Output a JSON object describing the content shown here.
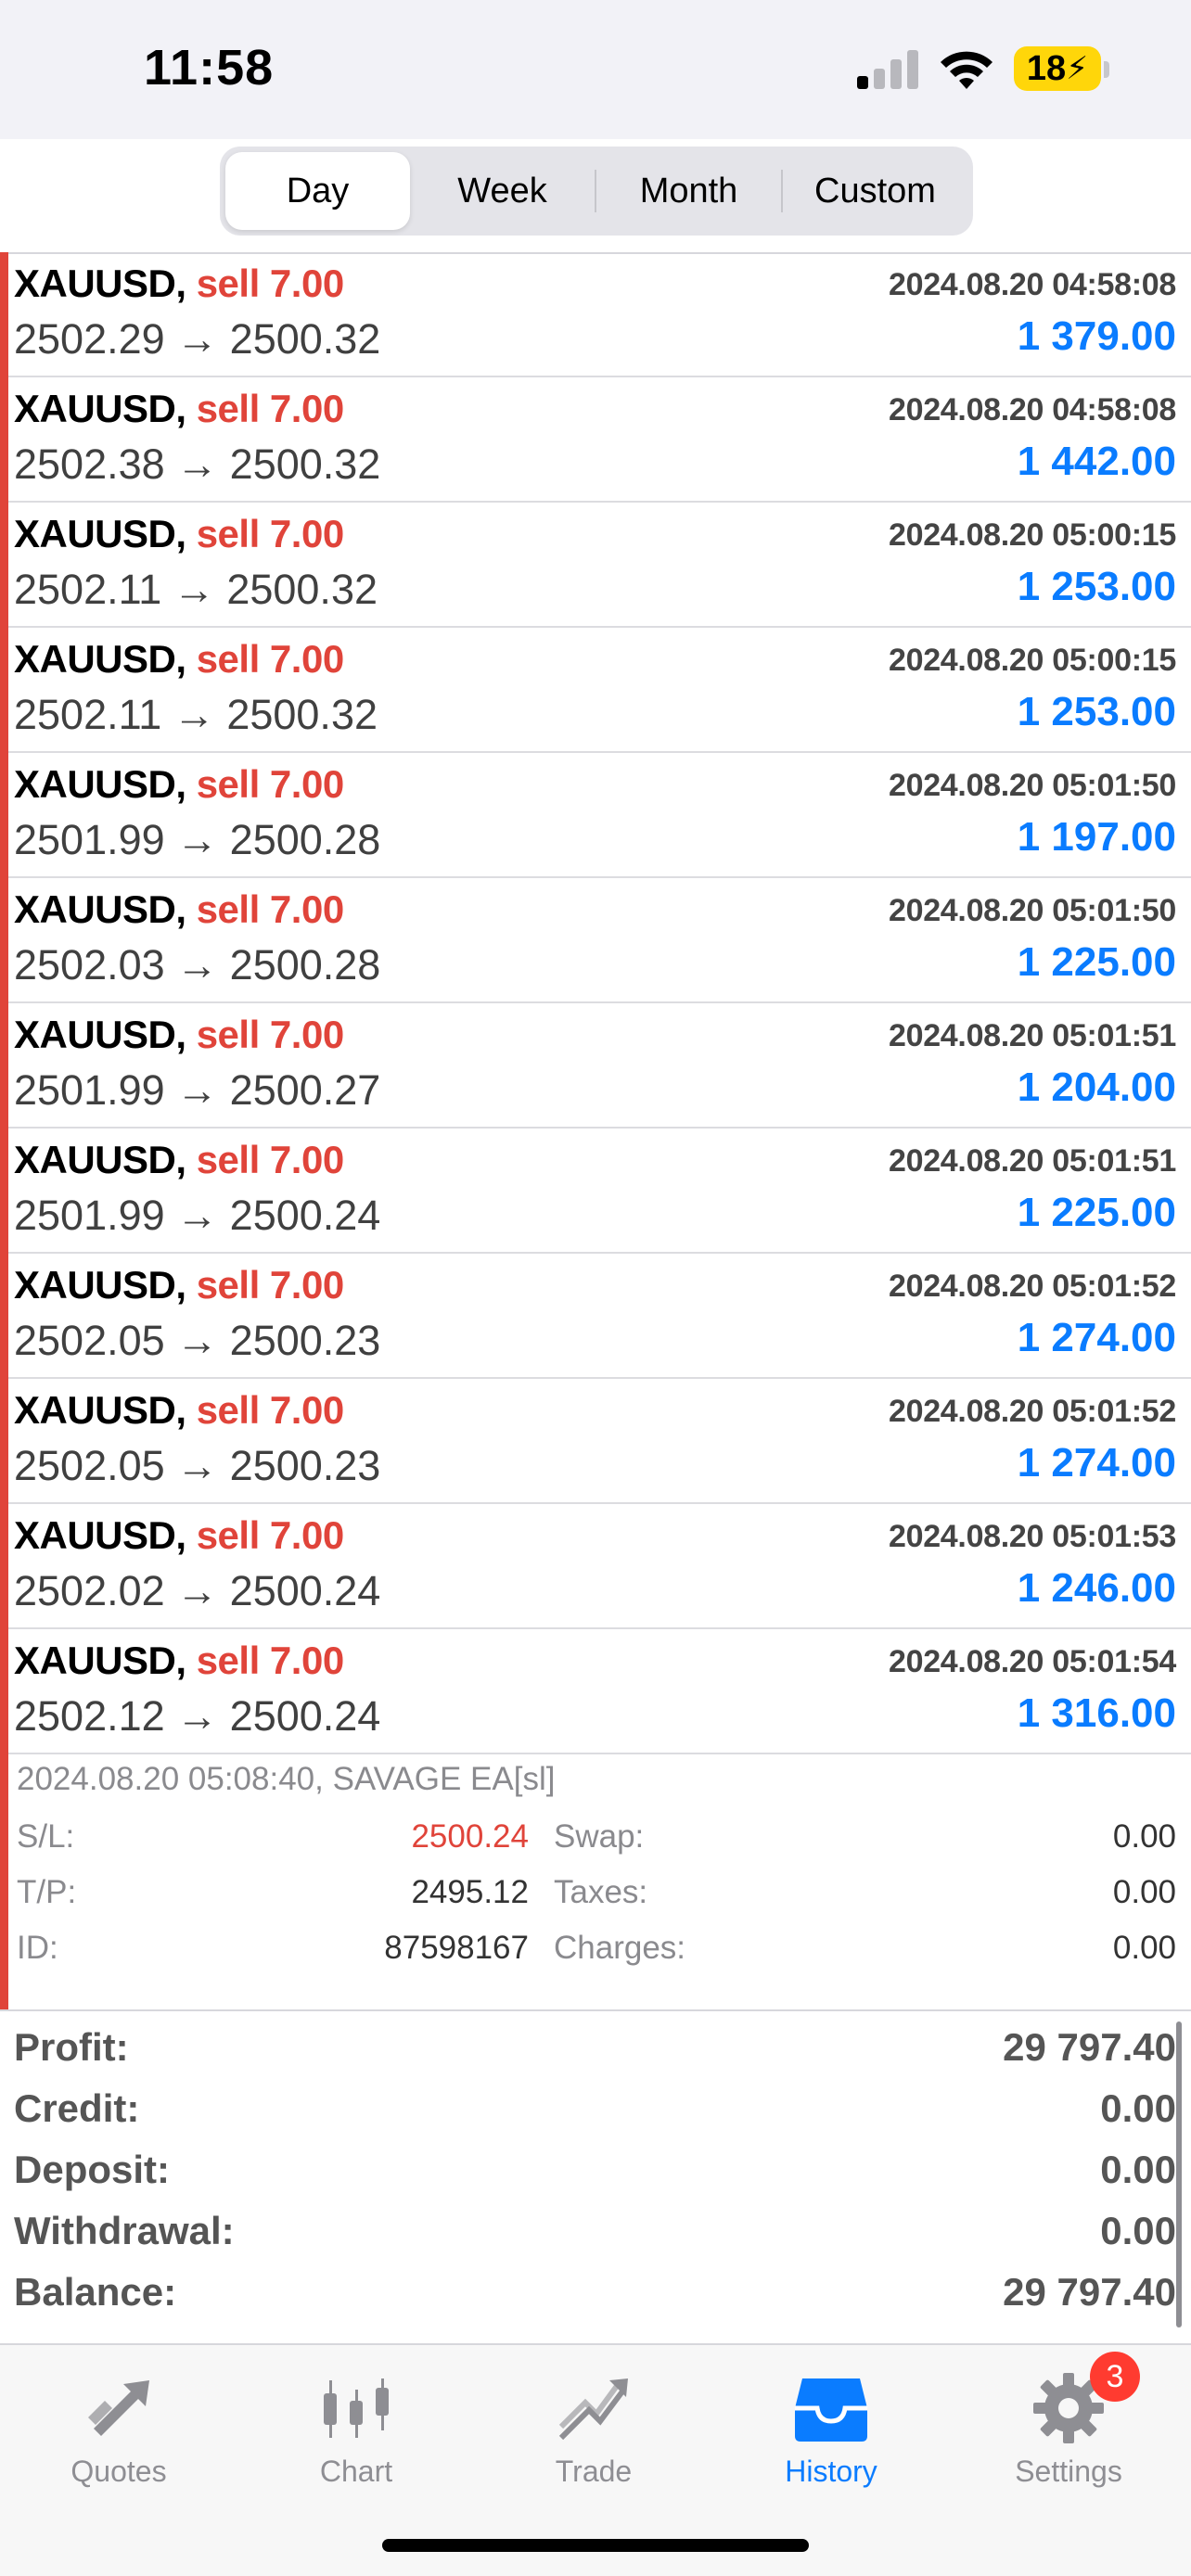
{
  "status_bar": {
    "time": "11:58",
    "battery": "18"
  },
  "segments": [
    {
      "label": "Day",
      "active": true
    },
    {
      "label": "Week",
      "active": false
    },
    {
      "label": "Month",
      "active": false
    },
    {
      "label": "Custom",
      "active": false
    }
  ],
  "trades": [
    {
      "symbol": "XAUUSD,",
      "side": "sell 7.00",
      "date": "2024.08.20 04:58:08",
      "prices": "2502.29 → 2500.32",
      "profit": "1 379.00"
    },
    {
      "symbol": "XAUUSD,",
      "side": "sell 7.00",
      "date": "2024.08.20 04:58:08",
      "prices": "2502.38 → 2500.32",
      "profit": "1 442.00"
    },
    {
      "symbol": "XAUUSD,",
      "side": "sell 7.00",
      "date": "2024.08.20 05:00:15",
      "prices": "2502.11 → 2500.32",
      "profit": "1 253.00"
    },
    {
      "symbol": "XAUUSD,",
      "side": "sell 7.00",
      "date": "2024.08.20 05:00:15",
      "prices": "2502.11 → 2500.32",
      "profit": "1 253.00"
    },
    {
      "symbol": "XAUUSD,",
      "side": "sell 7.00",
      "date": "2024.08.20 05:01:50",
      "prices": "2501.99 → 2500.28",
      "profit": "1 197.00"
    },
    {
      "symbol": "XAUUSD,",
      "side": "sell 7.00",
      "date": "2024.08.20 05:01:50",
      "prices": "2502.03 → 2500.28",
      "profit": "1 225.00"
    },
    {
      "symbol": "XAUUSD,",
      "side": "sell 7.00",
      "date": "2024.08.20 05:01:51",
      "prices": "2501.99 → 2500.27",
      "profit": "1 204.00"
    },
    {
      "symbol": "XAUUSD,",
      "side": "sell 7.00",
      "date": "2024.08.20 05:01:51",
      "prices": "2501.99 → 2500.24",
      "profit": "1 225.00"
    },
    {
      "symbol": "XAUUSD,",
      "side": "sell 7.00",
      "date": "2024.08.20 05:01:52",
      "prices": "2502.05 → 2500.23",
      "profit": "1 274.00"
    },
    {
      "symbol": "XAUUSD,",
      "side": "sell 7.00",
      "date": "2024.08.20 05:01:52",
      "prices": "2502.05 → 2500.23",
      "profit": "1 274.00"
    },
    {
      "symbol": "XAUUSD,",
      "side": "sell 7.00",
      "date": "2024.08.20 05:01:53",
      "prices": "2502.02 → 2500.24",
      "profit": "1 246.00"
    },
    {
      "symbol": "XAUUSD,",
      "side": "sell 7.00",
      "date": "2024.08.20 05:01:54",
      "prices": "2502.12 → 2500.24",
      "profit": "1 316.00"
    }
  ],
  "details": {
    "header": "2024.08.20 05:08:40, SAVAGE EA[sl]",
    "sl_label": "S/L:",
    "sl_value": "2500.24",
    "tp_label": "T/P:",
    "tp_value": "2495.12",
    "id_label": "ID:",
    "id_value": "87598167",
    "swap_label": "Swap:",
    "swap_value": "0.00",
    "taxes_label": "Taxes:",
    "taxes_value": "0.00",
    "charges_label": "Charges:",
    "charges_value": "0.00"
  },
  "summary": [
    {
      "label": "Profit:",
      "value": "29 797.40"
    },
    {
      "label": "Credit:",
      "value": "0.00"
    },
    {
      "label": "Deposit:",
      "value": "0.00"
    },
    {
      "label": "Withdrawal:",
      "value": "0.00"
    },
    {
      "label": "Balance:",
      "value": "29 797.40"
    }
  ],
  "tabs": [
    {
      "label": "Quotes",
      "icon": "quotes-icon"
    },
    {
      "label": "Chart",
      "icon": "chart-icon"
    },
    {
      "label": "Trade",
      "icon": "trade-icon"
    },
    {
      "label": "History",
      "icon": "history-icon",
      "active": true
    },
    {
      "label": "Settings",
      "icon": "gear-icon",
      "badge": "3"
    }
  ],
  "colors": {
    "sell": "#e0443a",
    "profit": "#0a7cff",
    "active_tab": "#0a7cff"
  }
}
